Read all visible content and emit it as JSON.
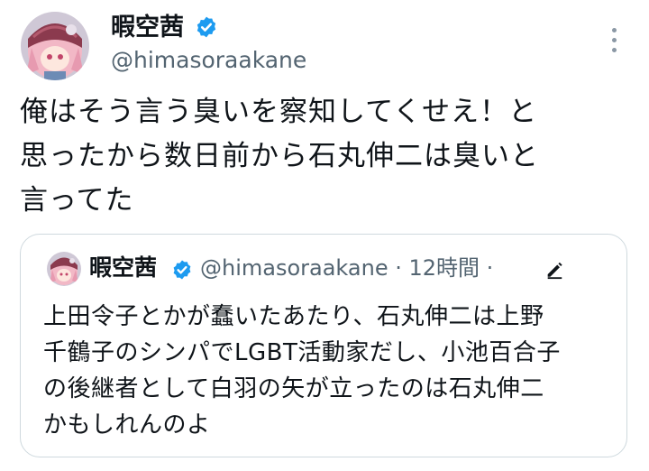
{
  "author": {
    "name": "暇空茜",
    "handle": "@himasoraakane",
    "verified": true
  },
  "tweet": {
    "lines": [
      "俺はそう言う臭いを察知してくせえ！と",
      "思ったから数日前から石丸伸二は臭いと",
      "言ってた"
    ]
  },
  "quoted": {
    "name": "暇空茜",
    "meta": "@himasoraakane · 12時間 ·",
    "lines": [
      "上田令子とかが蠢いたあたり、石丸伸二は上野",
      "千鶴子のシンパでLGBT活動家だし、小池百合子",
      "の後継者として白羽の矢が立ったのは石丸伸二",
      "かもしれんのよ"
    ]
  },
  "icons": {
    "verified": "verified-badge-icon",
    "more": "more-options-icon",
    "edit": "edited-pencil-icon"
  },
  "colors": {
    "verified": "#1d9bf0",
    "secondary_text": "#536471",
    "border": "#cfd9de"
  }
}
